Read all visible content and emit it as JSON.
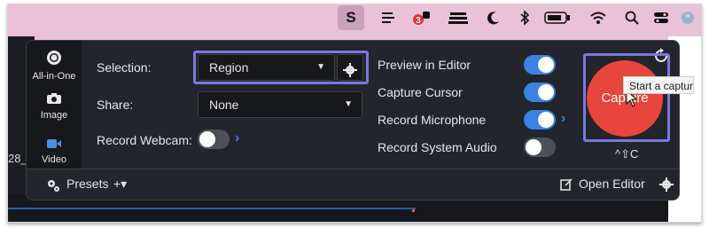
{
  "background": {
    "left_text": "28_"
  },
  "menubar": {
    "icons": [
      "snagit-icon",
      "menu-lines-icon",
      "notification-badge-icon",
      "stack-icon",
      "moon-icon",
      "bluetooth-icon",
      "battery-icon",
      "wifi-icon",
      "search-icon",
      "control-center-icon",
      "user-avatar-icon"
    ],
    "badge_count": "3",
    "snagit_letter": "S"
  },
  "panel": {
    "modes": [
      {
        "label": "All-in-One",
        "icon": "all-in-one-icon"
      },
      {
        "label": "Image",
        "icon": "camera-icon"
      },
      {
        "label": "Video",
        "icon": "video-camera-icon",
        "active": true
      }
    ],
    "selection": {
      "label": "Selection:",
      "value": "Region"
    },
    "share": {
      "label": "Share:",
      "value": "None"
    },
    "record_webcam": {
      "label": "Record Webcam:",
      "on": false
    },
    "options": [
      {
        "label": "Preview in Editor",
        "on": true
      },
      {
        "label": "Capture Cursor",
        "on": true
      },
      {
        "label": "Record Microphone",
        "on": true
      },
      {
        "label": "Record System Audio",
        "on": false
      }
    ],
    "capture": {
      "label": "Capture",
      "shortcut": "^⇧C",
      "tooltip": "Start a capture w"
    },
    "bottom": {
      "presets": "Presets",
      "add": "+▾",
      "open_editor": "Open Editor"
    },
    "colors": {
      "accent": "#3b82e6",
      "capture": "#e8463c",
      "highlight": "#7b78e0"
    }
  }
}
